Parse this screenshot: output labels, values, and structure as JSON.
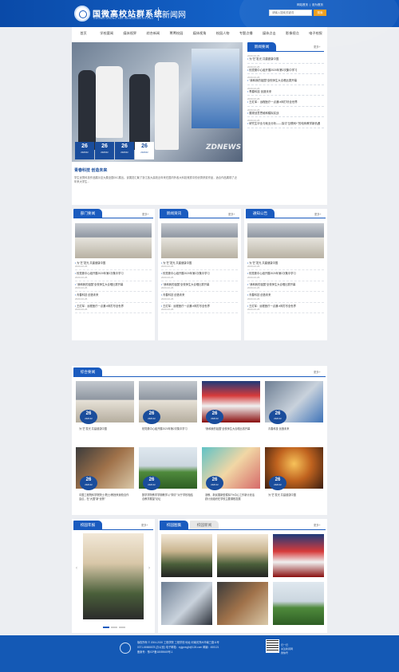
{
  "header": {
    "site_title": "国微高校站群系统",
    "site_subtitle": "GUOWEI ZHONG XUE WANGZHAN XITONG",
    "section_title": "新闻网",
    "top_links": [
      "网站首页",
      "|",
      "设为首页"
    ],
    "search_placeholder": "请输入搜索关键词",
    "search_button": "搜索"
  },
  "nav": [
    "首页",
    "学校要闻",
    "媒体视界",
    "综合新闻",
    "菁菁校园",
    "媒体视角",
    "校园人物",
    "专题点播",
    "媒体点击",
    "影像视点",
    "电子校报"
  ],
  "hero": {
    "headline": "青春科技 创造未来",
    "summary": "学生优秀科技作品展示至大展全国00C展出。该展览汇聚了浙江各大高校近年来在国内外各大科技竞赛中的优秀获奖作品，适合作品展现了近年来大学生...",
    "watermark": "ZDNEWS",
    "dates": [
      {
        "day": "26",
        "ym": "2020/02"
      },
      {
        "day": "26",
        "ym": "2020/02"
      },
      {
        "day": "26",
        "ym": "2020/02"
      },
      {
        "day": "26",
        "ym": "2020/02"
      }
    ]
  },
  "latest_news": {
    "tab": "新闻要闻",
    "more": "更多+",
    "items": [
      {
        "date": "2020-02-26",
        "title": "为“艺”发光 共建健康中国"
      },
      {
        "date": "2020-02-26",
        "title": "校党委中心组开展2020年第2次集中学习"
      },
      {
        "date": "2020-02-26",
        "title": "“我和我的祖国”全校师生大合唱比赛开幕"
      },
      {
        "date": "2020-02-26",
        "title": "青春科技 创造未来"
      },
      {
        "date": "2020-02-26",
        "title": "王红军：远程医疗一点通 e网打尽全世界"
      },
      {
        "date": "2020-02-26",
        "title": "展现创意思维和模拟实战"
      },
      {
        "date": "2020-02-26",
        "title": "研究生毕业与就业分析——探讨“互联网+”的电商教学新机遇"
      }
    ]
  },
  "columns": [
    {
      "tab": "部门要闻",
      "more": "更多+",
      "items": [
        {
          "title": "为“艺”发光 共建健康中国",
          "date": "2020-02-26"
        },
        {
          "title": "校党委中心组开展2020年第2次集中学习",
          "date": "2020-02-26"
        },
        {
          "title": "“我和我的祖国”全校师生大合唱比赛开幕",
          "date": "2020-02-26"
        },
        {
          "title": "青春科技 创造未来",
          "date": "2020-02-26"
        },
        {
          "title": "王红军：远程医疗一点通 e网打尽全世界",
          "date": "2020-02-26"
        }
      ]
    },
    {
      "tab": "新闻资讯",
      "more": "更多+",
      "items": [
        {
          "title": "为“艺”发光 共建健康中国",
          "date": "2020-02-26"
        },
        {
          "title": "校党委中心组开展2020年第2次集中学习",
          "date": "2020-02-26"
        },
        {
          "title": "“我和我的祖国”全校师生大合唱比赛开幕",
          "date": "2020-02-26"
        },
        {
          "title": "青春科技 创造未来",
          "date": "2020-02-26"
        },
        {
          "title": "王红军：远程医疗一点通 e网打尽全世界",
          "date": "2020-02-26"
        }
      ]
    },
    {
      "tab": "通知公告",
      "more": "更多+",
      "items": [
        {
          "title": "为“艺”发光 共建健康中国",
          "date": "2020-02-26"
        },
        {
          "title": "校党委中心组开展2020年第2次集中学习",
          "date": "2020-02-26"
        },
        {
          "title": "“我和我的祖国”全校师生大合唱比赛开幕",
          "date": "2020-02-26"
        },
        {
          "title": "青春科技 创造未来",
          "date": "2020-02-26"
        },
        {
          "title": "王红军：远程医疗一点通 e网打尽全世界",
          "date": "2020-02-26"
        }
      ]
    }
  ],
  "composite": {
    "tab": "综合要闻",
    "more": "更多+",
    "cards": [
      {
        "day": "26",
        "ym": "2020.02",
        "caption": "为“艺”发光 共建健康中国"
      },
      {
        "day": "26",
        "ym": "2020.02",
        "caption": "校党委中心组开展2020年第2次集中学习"
      },
      {
        "day": "26",
        "ym": "2020.02",
        "caption": "“我和我的祖国”全校师生大合唱比赛开幕"
      },
      {
        "day": "26",
        "ym": "2020.02",
        "caption": "青春科技 创造未来"
      },
      {
        "day": "26",
        "ym": "2020.02",
        "caption": "中国工程院科学院院士/院士/教授来我校合作会议，在“大国”新“优势”"
      },
      {
        "day": "26",
        "ym": "2020.02",
        "caption": "数学学院教学学期教学以“事情”“对于学校相结合教学展望”论坛"
      },
      {
        "day": "26",
        "ym": "2020.02",
        "caption": "浙教、新民展新型模拟7%中心工作新计划活跃计划组织在学校主要课程发展"
      },
      {
        "day": "26",
        "ym": "2020.02",
        "caption": "为“艺”发光 共建健康中国"
      }
    ]
  },
  "campus_paper": {
    "tab": "校园年报",
    "more": "更多+"
  },
  "campus_gallery": {
    "tabs": [
      "校园图集",
      "校园新闻"
    ],
    "more": "更多+"
  },
  "footer": {
    "lines": [
      "版权所有 © 2004-2020 工程学院 工程学校  地址:河南省郑州市南三路11号",
      "0371-66666678 (办公室)  电子邮箱：xyjgrzsyjb@126.com  邮编：450121",
      "备案号：豫ICP备18059669号-1"
    ],
    "qr_lines": [
      "扫一扫",
      "关注新闻网",
      "微信号"
    ]
  },
  "colors": {
    "primary": "#1a5bbf",
    "dark_blue": "#1a4d9c",
    "accent": "#f0a020",
    "footer": "#1459b5"
  }
}
